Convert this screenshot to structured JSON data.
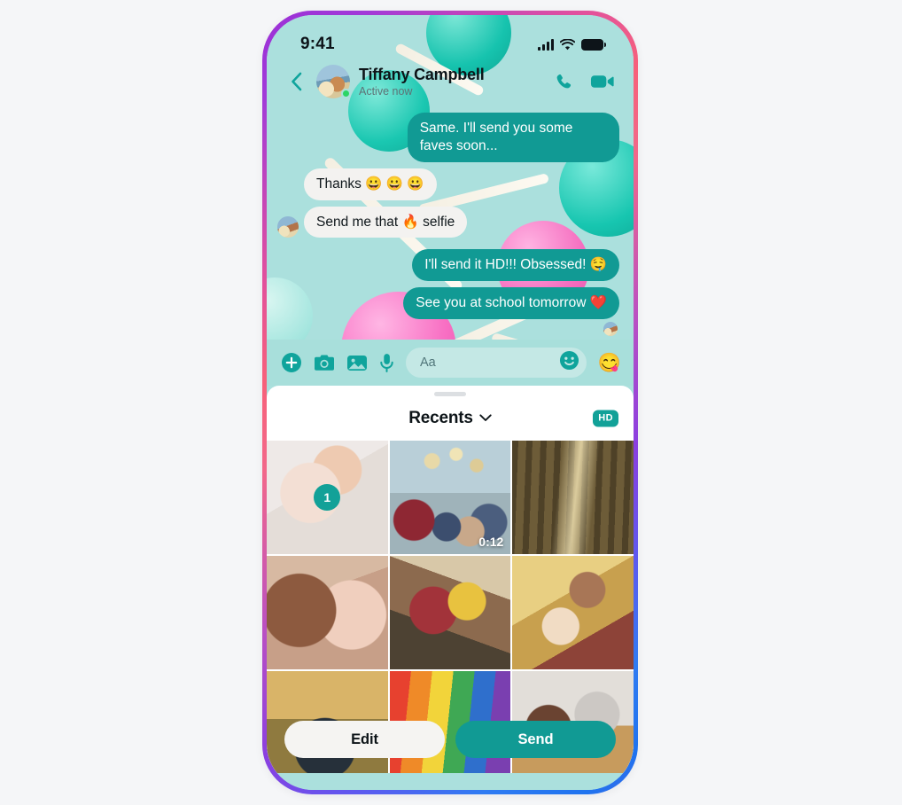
{
  "status_bar": {
    "time": "9:41",
    "signal_icon": "cellular-signal-icon",
    "wifi_icon": "wifi-icon",
    "battery_icon": "battery-icon"
  },
  "chat_header": {
    "back_icon": "back-chevron-icon",
    "avatar_alt": "tiffany-campbell-avatar",
    "name": "Tiffany Campbell",
    "status": "Active now",
    "online": true,
    "call_icon": "phone-call-icon",
    "video_icon": "video-call-icon"
  },
  "conversation": {
    "messages": [
      {
        "id": "m1",
        "direction": "out",
        "text": "Same. I'll send you some faves soon..."
      },
      {
        "id": "m2",
        "direction": "in",
        "text": "Thanks 😀 😀 😀"
      },
      {
        "id": "m3",
        "direction": "in",
        "text": "Send me that 🔥 selfie",
        "show_avatar": true
      },
      {
        "id": "m4",
        "direction": "out",
        "text": "I'll send it HD!!! Obsessed! 🤤"
      },
      {
        "id": "m5",
        "direction": "out",
        "text": "See you at school tomorrow ❤️"
      }
    ]
  },
  "composer": {
    "plus_icon": "plus-circle-icon",
    "camera_icon": "camera-icon",
    "gallery_icon": "photo-gallery-icon",
    "mic_icon": "microphone-icon",
    "input_placeholder": "Aa",
    "input_value": "",
    "sticker_icon": "smiley-sticker-icon",
    "emoji_quick": "😋"
  },
  "gallery_sheet": {
    "grabber": "sheet-drag-handle",
    "title": "Recents",
    "title_chevron_icon": "chevron-down-icon",
    "hd_badge": "HD",
    "photos": [
      {
        "id": "p1",
        "kind": "photo",
        "art": "ph-selfie",
        "selected": true,
        "selection_number": "1"
      },
      {
        "id": "p2",
        "kind": "video",
        "art": "ph-confetti",
        "duration": "0:12"
      },
      {
        "id": "p3",
        "kind": "photo",
        "art": "ph-forest"
      },
      {
        "id": "p4",
        "kind": "photo",
        "art": "ph-two-girls"
      },
      {
        "id": "p5",
        "kind": "photo",
        "art": "ph-window"
      },
      {
        "id": "p6",
        "kind": "photo",
        "art": "ph-bed"
      },
      {
        "id": "p7",
        "kind": "photo",
        "art": "ph-field"
      },
      {
        "id": "p8",
        "kind": "photo",
        "art": "ph-parade"
      },
      {
        "id": "p9",
        "kind": "photo",
        "art": "ph-kitchen"
      }
    ],
    "actions": {
      "edit_label": "Edit",
      "send_label": "Send"
    }
  },
  "colors": {
    "accent_teal": "#119a94",
    "wallpaper_mint": "#abe0dd",
    "composer_mint": "#a8dfdb",
    "incoming_bubble": "#f3f2f0",
    "online_green": "#2bd566",
    "frame_gradient_start": "#9b2fd6",
    "frame_gradient_pink": "#f7617a",
    "frame_gradient_blue": "#1f73ef"
  }
}
